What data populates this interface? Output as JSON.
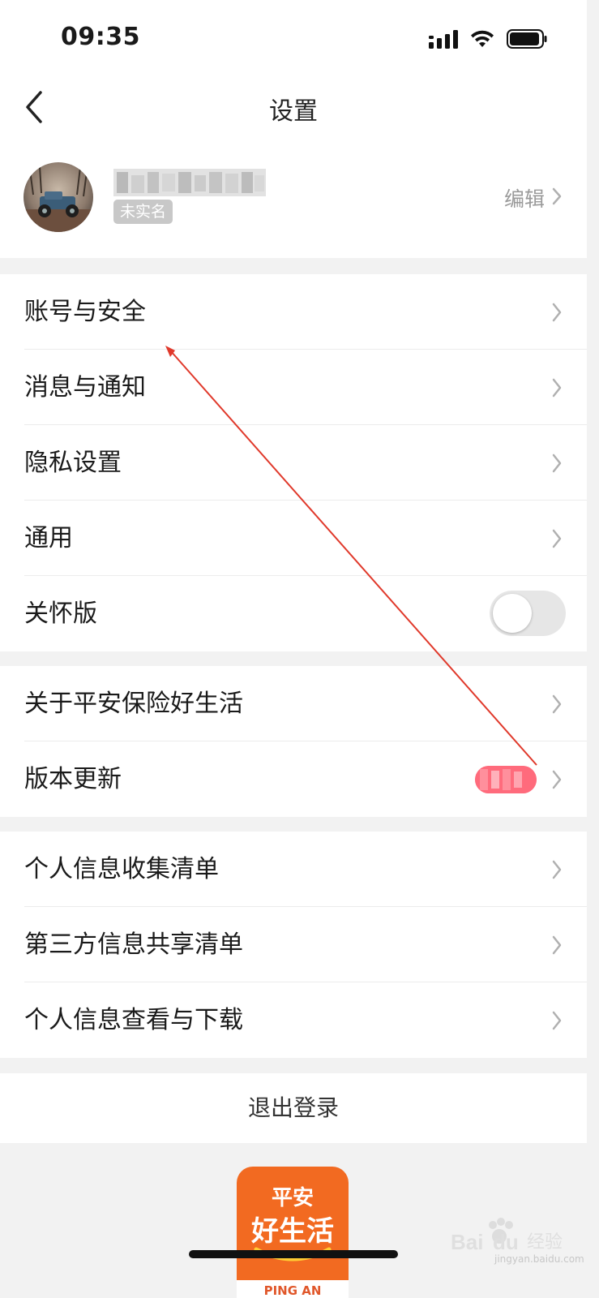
{
  "status_bar": {
    "time": "09:35"
  },
  "nav": {
    "title": "设置"
  },
  "profile": {
    "realname_tag": "未实名",
    "edit_label": "编辑"
  },
  "groups": {
    "g1": [
      {
        "label": "账号与安全"
      },
      {
        "label": "消息与通知"
      },
      {
        "label": "隐私设置"
      },
      {
        "label": "通用"
      },
      {
        "label": "关怀版"
      }
    ],
    "g2": [
      {
        "label": "关于平安保险好生活"
      },
      {
        "label": "版本更新"
      }
    ],
    "g3": [
      {
        "label": "个人信息收集清单"
      },
      {
        "label": "第三方信息共享清单"
      },
      {
        "label": "个人信息查看与下载"
      }
    ]
  },
  "care_mode_enabled": false,
  "logout_label": "退出登录",
  "logo": {
    "top": "平安",
    "main": "好生活",
    "bottom": "PING AN"
  },
  "watermark": {
    "text": "jingyan.baidu.com"
  },
  "colors": {
    "accent_arrow": "#e0392b",
    "logo_orange": "#f26a21",
    "badge_red": "#ff5a6e"
  }
}
